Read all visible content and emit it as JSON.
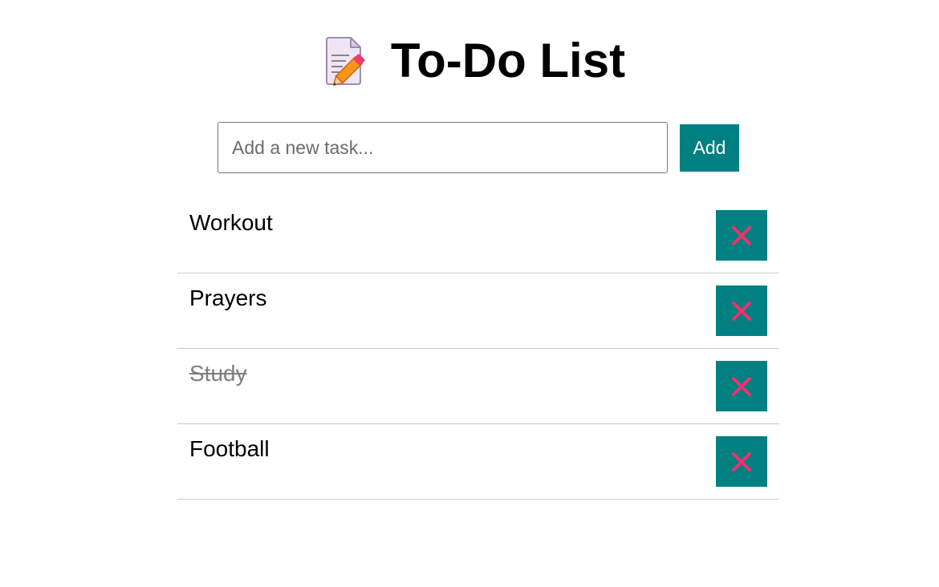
{
  "header": {
    "icon": "memo-pencil-icon",
    "title": "To-Do List"
  },
  "input": {
    "placeholder": "Add a new task...",
    "value": "",
    "add_label": "Add"
  },
  "tasks": [
    {
      "label": "Workout",
      "done": false,
      "delete_icon": "cross-mark-icon"
    },
    {
      "label": "Prayers",
      "done": false,
      "delete_icon": "cross-mark-icon"
    },
    {
      "label": "Study",
      "done": true,
      "delete_icon": "cross-mark-icon"
    },
    {
      "label": "Football",
      "done": false,
      "delete_icon": "cross-mark-icon"
    }
  ],
  "colors": {
    "accent": "#008080",
    "delete_cross": "#f0326e",
    "done_text": "#808080",
    "divider": "#cccccc"
  }
}
